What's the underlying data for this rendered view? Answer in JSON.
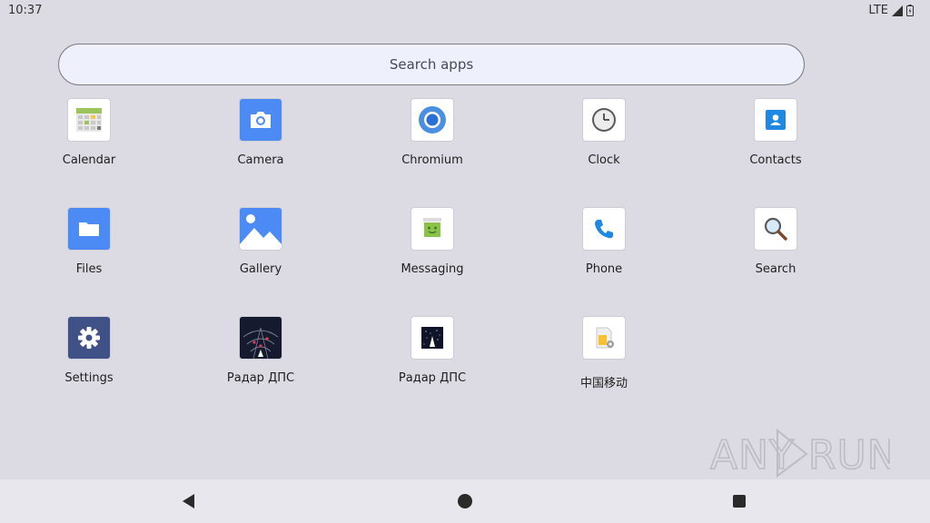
{
  "status_bar": {
    "time": "10:37",
    "network": "LTE"
  },
  "search": {
    "placeholder": "Search apps"
  },
  "apps": [
    {
      "label": "Calendar",
      "icon": "calendar-icon"
    },
    {
      "label": "Camera",
      "icon": "camera-icon"
    },
    {
      "label": "Chromium",
      "icon": "chromium-icon"
    },
    {
      "label": "Clock",
      "icon": "clock-icon"
    },
    {
      "label": "Contacts",
      "icon": "contacts-icon"
    },
    {
      "label": "Files",
      "icon": "folder-icon"
    },
    {
      "label": "Gallery",
      "icon": "gallery-icon"
    },
    {
      "label": "Messaging",
      "icon": "messaging-icon"
    },
    {
      "label": "Phone",
      "icon": "phone-icon"
    },
    {
      "label": "Search",
      "icon": "magnifier-icon"
    },
    {
      "label": "Settings",
      "icon": "gear-icon"
    },
    {
      "label": "Радар ДПС",
      "icon": "radar-icon"
    },
    {
      "label": "Радар ДПС",
      "icon": "radar-dark-icon"
    },
    {
      "label": "中国移动",
      "icon": "sim-card-icon"
    }
  ],
  "navigation": {
    "back": "back-icon",
    "home": "home-icon",
    "recents": "recents-icon"
  },
  "watermark": {
    "text": "ANY RUN"
  },
  "colors": {
    "background": "#dcdae3",
    "navbar": "#e9e7ee",
    "search_bg": "#eef0fb"
  }
}
